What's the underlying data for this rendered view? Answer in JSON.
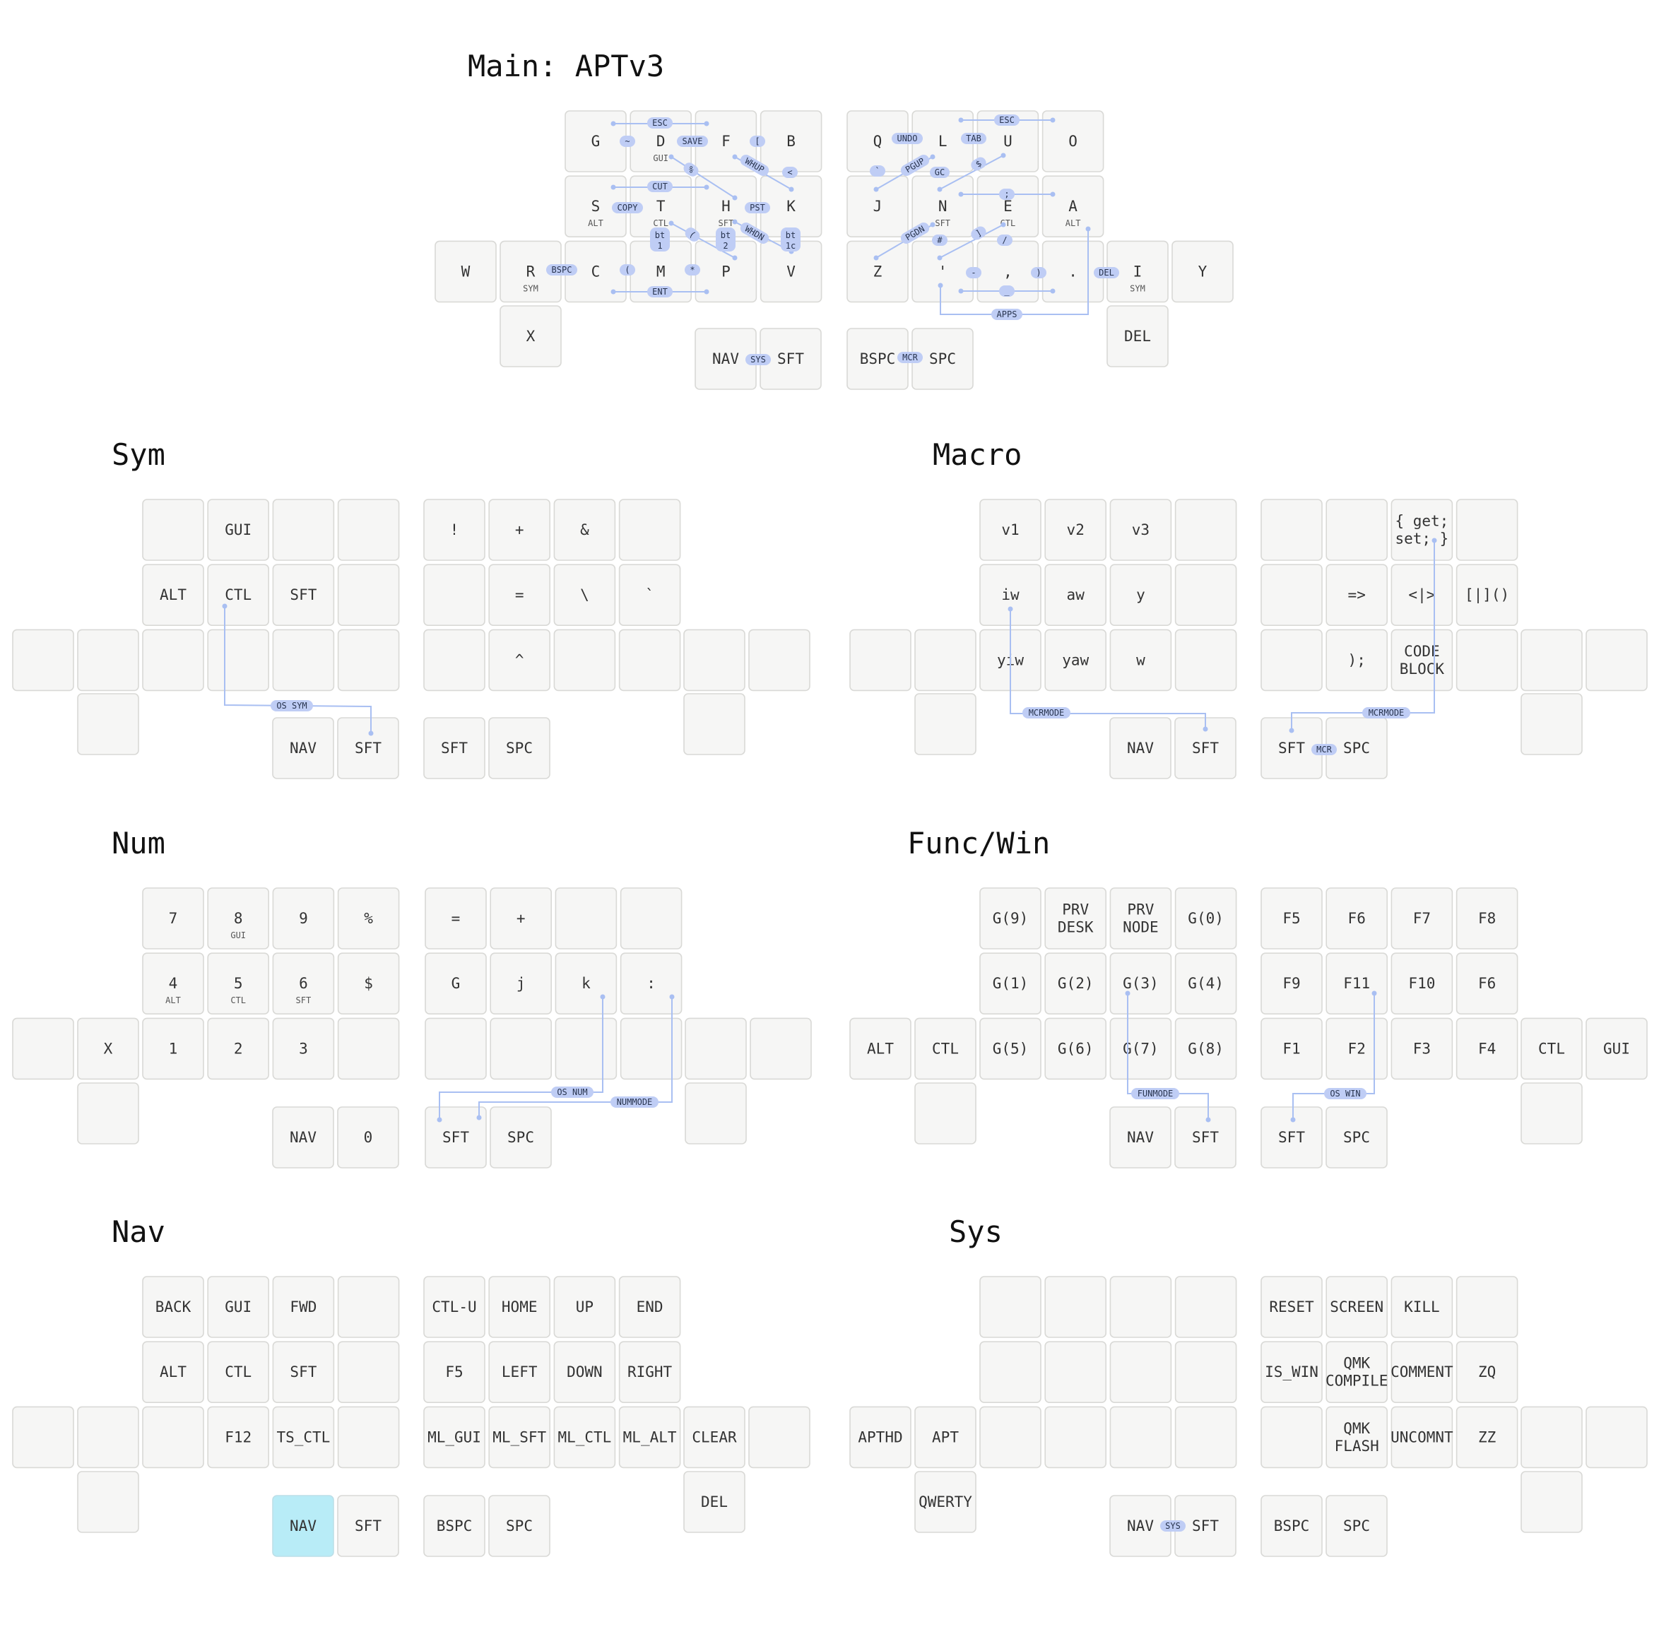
{
  "colors": {
    "key_fill": "#f6f6f5",
    "key_border": "#d9d9d6",
    "held_key": "#b8ecf7",
    "combo": "#a9bff2",
    "combo_pill": "#bfcdf5"
  },
  "layers": [
    {
      "title": "Main: APTv3",
      "left": [
        [
          "G",
          "D",
          "F",
          "B"
        ],
        [
          "S",
          "T",
          "H",
          "K"
        ],
        [
          "C",
          "M",
          "P",
          "V"
        ]
      ],
      "left_hold": [
        [
          "",
          "GUI",
          "",
          ""
        ],
        [
          "ALT",
          "CTL",
          "SFT",
          ""
        ],
        [
          "",
          "",
          "",
          ""
        ]
      ],
      "left_outer": [
        "W",
        "R"
      ],
      "left_outer_hold": [
        "",
        "SYM"
      ],
      "left_extra": "X",
      "left_thumbs": [
        "NAV",
        "SFT"
      ],
      "right": [
        [
          "Q",
          "L",
          "U",
          "O"
        ],
        [
          "J",
          "N",
          "E",
          "A"
        ],
        [
          "Z",
          "'",
          ",",
          "."
        ]
      ],
      "right_hold": [
        [
          "",
          "",
          "",
          ""
        ],
        [
          "",
          "SFT",
          "CTL",
          "ALT"
        ],
        [
          "",
          "",
          "",
          ""
        ]
      ],
      "right_outer": [
        "I",
        "Y"
      ],
      "right_outer_hold": [
        "SYM",
        ""
      ],
      "right_extra": "DEL",
      "right_thumbs": [
        "BSPC",
        "SPC"
      ],
      "combos": [
        "ESC",
        "~",
        "SAVE",
        "[",
        "%",
        "WHUP",
        "<",
        "CUT",
        "COPY",
        "PST",
        "(",
        "WHDN",
        "bt 1",
        "bt 2",
        "bt 1c",
        "BSPC",
        "(",
        "*",
        "ENT",
        "SYS",
        "ESC",
        "UNDO",
        "TAB",
        "`",
        "PGUP",
        "GC",
        "$",
        ";",
        "PGDN",
        "#",
        "]",
        "/",
        "-",
        ")",
        "DEL",
        "_",
        "APPS",
        "MCR"
      ]
    },
    {
      "title": "Sym",
      "left": [
        [
          "",
          "GUI",
          "",
          ""
        ],
        [
          "ALT",
          "CTL",
          "SFT",
          ""
        ],
        [
          "",
          "",
          "",
          ""
        ]
      ],
      "left_outer": [
        "",
        ""
      ],
      "left_extra": "",
      "left_thumbs": [
        "NAV",
        "SFT"
      ],
      "right": [
        [
          "!",
          "+",
          "&",
          ""
        ],
        [
          "",
          "=",
          "\\",
          "`"
        ],
        [
          "",
          "^",
          "",
          ""
        ]
      ],
      "right_outer": [
        "",
        ""
      ],
      "right_extra": "",
      "right_thumbs": [
        "SFT",
        "SPC"
      ],
      "combos": [
        "OS SYM"
      ]
    },
    {
      "title": "Macro",
      "left": [
        [
          "v1",
          "v2",
          "v3",
          ""
        ],
        [
          "iw",
          "aw",
          "y",
          ""
        ],
        [
          "yiw",
          "yaw",
          "w",
          ""
        ]
      ],
      "left_outer": [
        "",
        ""
      ],
      "left_extra": "",
      "left_thumbs": [
        "NAV",
        "SFT"
      ],
      "right": [
        [
          "",
          "",
          "{ get; set; }",
          ""
        ],
        [
          "",
          "=>",
          "<|>",
          "[|]()"
        ],
        [
          "",
          ");",
          "CODE BLOCK",
          ""
        ]
      ],
      "right_outer": [
        "",
        ""
      ],
      "right_extra": "",
      "right_thumbs": [
        "SFT",
        "SPC"
      ],
      "combos": [
        "MCRMODE",
        "MCRMODE",
        "MCR"
      ]
    },
    {
      "title": "Num",
      "left": [
        [
          "7",
          "8",
          "9",
          "%"
        ],
        [
          "4",
          "5",
          "6",
          "$"
        ],
        [
          "1",
          "2",
          "3",
          ""
        ]
      ],
      "left_hold": [
        [
          "",
          "GUI",
          "",
          ""
        ],
        [
          "ALT",
          "CTL",
          "SFT",
          ""
        ],
        [
          "",
          "",
          "",
          ""
        ]
      ],
      "left_outer": [
        "",
        "X"
      ],
      "left_extra": "",
      "left_thumbs": [
        "NAV",
        "0"
      ],
      "right": [
        [
          "=",
          "+",
          "",
          ""
        ],
        [
          "G",
          "j",
          "k",
          ":"
        ],
        [
          "",
          "",
          "",
          ""
        ]
      ],
      "right_outer": [
        "",
        ""
      ],
      "right_extra": "",
      "right_thumbs": [
        "SFT",
        "SPC"
      ],
      "combos": [
        "OS NUM",
        "NUMMODE"
      ]
    },
    {
      "title": "Func/Win",
      "left": [
        [
          "G(9)",
          "PRV DESK",
          "PRV NODE",
          "G(0)"
        ],
        [
          "G(1)",
          "G(2)",
          "G(3)",
          "G(4)"
        ],
        [
          "G(5)",
          "G(6)",
          "G(7)",
          "G(8)"
        ]
      ],
      "left_outer": [
        "ALT",
        "CTL"
      ],
      "left_extra": "",
      "left_thumbs": [
        "NAV",
        "SFT"
      ],
      "right": [
        [
          "F5",
          "F6",
          "F7",
          "F8"
        ],
        [
          "F9",
          "F11",
          "F10",
          "F6"
        ],
        [
          "F1",
          "F2",
          "F3",
          "F4"
        ]
      ],
      "right_outer": [
        "CTL",
        "GUI"
      ],
      "right_extra": "",
      "right_thumbs": [
        "SFT",
        "SPC"
      ],
      "combos": [
        "FUNMODE",
        "OS WIN"
      ]
    },
    {
      "title": "Nav",
      "left": [
        [
          "BACK",
          "GUI",
          "FWD",
          ""
        ],
        [
          "ALT",
          "CTL",
          "SFT",
          ""
        ],
        [
          "",
          "F12",
          "TS_CTL",
          ""
        ]
      ],
      "left_outer": [
        "",
        ""
      ],
      "left_extra": "",
      "left_thumbs": [
        "NAV",
        "SFT"
      ],
      "right": [
        [
          "CTL-U",
          "HOME",
          "UP",
          "END"
        ],
        [
          "F5",
          "LEFT",
          "DOWN",
          "RIGHT"
        ],
        [
          "ML_GUI",
          "ML_SFT",
          "ML_CTL",
          "ML_ALT"
        ]
      ],
      "right_outer": [
        "CLEAR",
        ""
      ],
      "right_extra": "DEL",
      "right_thumbs": [
        "BSPC",
        "SPC"
      ],
      "combos": []
    },
    {
      "title": "Sys",
      "left": [
        [
          "",
          "",
          "",
          ""
        ],
        [
          "",
          "",
          "",
          ""
        ],
        [
          "",
          "",
          "",
          ""
        ]
      ],
      "left_outer": [
        "APTHD",
        "APT"
      ],
      "left_extra": "QWERTY",
      "left_thumbs": [
        "NAV",
        "SFT"
      ],
      "right": [
        [
          "RESET",
          "SCREEN",
          "KILL",
          ""
        ],
        [
          "IS_WIN",
          "QMK COMPILE",
          "COMMENT",
          "ZQ"
        ],
        [
          "",
          "QMK FLASH",
          "UNCOMNT",
          "ZZ"
        ]
      ],
      "right_outer": [
        "",
        ""
      ],
      "right_extra": "",
      "right_thumbs": [
        "BSPC",
        "SPC"
      ],
      "combos": [
        "SYS"
      ]
    }
  ]
}
